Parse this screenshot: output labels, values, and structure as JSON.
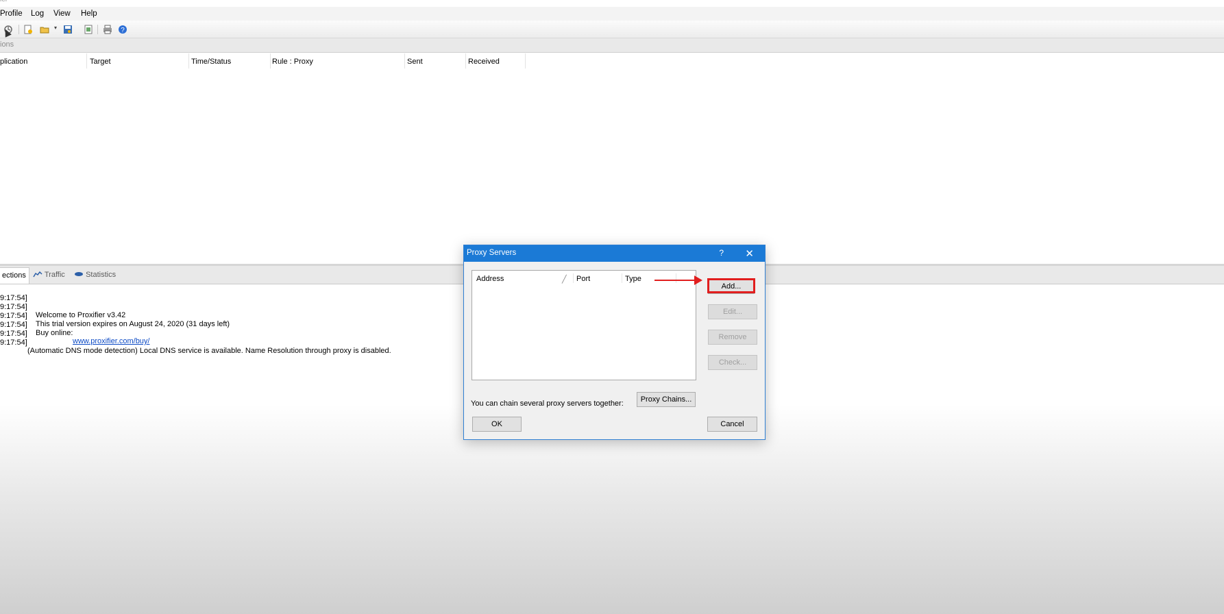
{
  "window": {
    "title_fragment": "ier"
  },
  "menu": [
    "Profile",
    "Log",
    "View",
    "Help"
  ],
  "toolbar": {
    "icons": [
      "connections-icon",
      "new-profile-icon",
      "open-profile-icon",
      "save-profile-icon",
      "proxy-servers-icon",
      "print-icon",
      "help-icon"
    ]
  },
  "section_label": "ions",
  "connections_table": {
    "columns": [
      "plication",
      "Target",
      "Time/Status",
      "Rule : Proxy",
      "Sent",
      "Received"
    ]
  },
  "bottom_tabs": [
    "ections",
    "Traffic",
    "Statistics"
  ],
  "log": [
    {
      "ts": "9:17:54]",
      "msg": ""
    },
    {
      "ts": "9:17:54]",
      "msg": "Welcome to Proxifier v3.42"
    },
    {
      "ts": "9:17:54]",
      "msg": "This trial version expires on August 24, 2020 (31 days left)"
    },
    {
      "ts": "9:17:54]",
      "msg": "Buy online: ",
      "link": "www.proxifier.com/buy/"
    },
    {
      "ts": "9:17:54]",
      "msg": ""
    },
    {
      "ts": "9:17:54]",
      "msg": "(Automatic DNS mode detection) Local DNS service is available. Name Resolution through proxy is disabled."
    }
  ],
  "dialog": {
    "title": "Proxy Servers",
    "help_glyph": "?",
    "close_glyph": "✕",
    "list_columns": [
      "Address",
      "Port",
      "Type"
    ],
    "sort_glyph": "╱",
    "buttons": {
      "add": "Add...",
      "edit": "Edit...",
      "remove": "Remove",
      "check": "Check..."
    },
    "chain_text": "You can chain several proxy servers together:",
    "proxy_chains": "Proxy Chains...",
    "ok": "OK",
    "cancel": "Cancel"
  },
  "annotation": {
    "color": "#e11e1e"
  },
  "colors": {
    "title_bar": "#1b7ad6",
    "link": "#0b49c4"
  }
}
